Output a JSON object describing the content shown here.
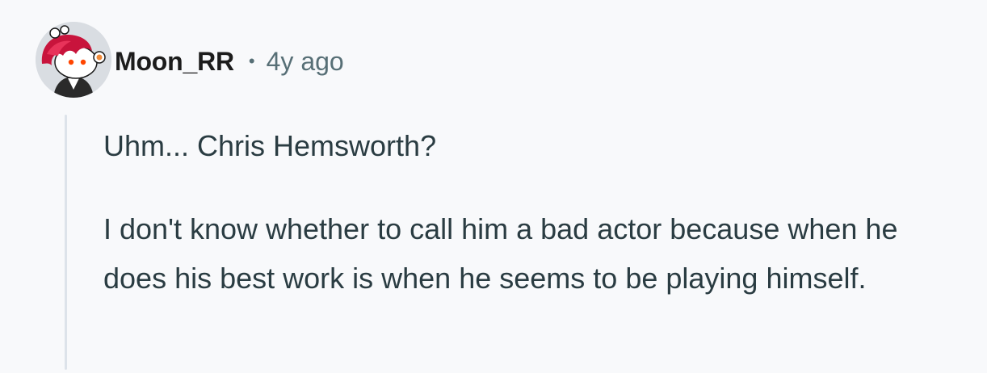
{
  "comment": {
    "author": "Moon_RR",
    "separator": "•",
    "age": "4y ago",
    "avatar_icon": "reddit-snoo-avatar-red-hair",
    "paragraphs": [
      "Uhm... Chris Hemsworth?",
      "I don't know whether to call him a bad actor because when he does his best work is when he seems to be playing himself."
    ]
  },
  "colors": {
    "background": "#f8f9fb",
    "username": "#1c1c1c",
    "meta": "#576f76",
    "body_text": "#2a3c42",
    "thread_line": "#dde3ea",
    "avatar_hair": "#c8143c"
  }
}
